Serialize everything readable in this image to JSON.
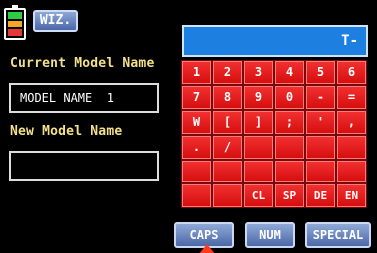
{
  "toolbar": {
    "wizard_label": "WIZ."
  },
  "battery": {
    "icon": "battery-icon"
  },
  "current_model": {
    "label": "Current Model Name",
    "value": "MODEL NAME  1"
  },
  "new_model": {
    "label": "New Model Name",
    "value": ""
  },
  "keyboard": {
    "display": "T-",
    "keys": [
      "1",
      "2",
      "3",
      "4",
      "5",
      "6",
      "7",
      "8",
      "9",
      "0",
      "-",
      "=",
      "W",
      "[",
      "]",
      ";",
      "'",
      ",",
      ".",
      "/",
      "",
      "",
      "",
      "",
      "",
      "",
      "",
      "",
      "",
      "",
      "",
      "",
      "CL",
      "SP",
      "DE",
      "EN"
    ]
  },
  "modes": {
    "caps": "CAPS",
    "num": "NUM",
    "special": "SPECIAL"
  },
  "colors": {
    "accent_blue": "#1d7fe0",
    "key_red": "#e61f1f",
    "label_yellow": "#f3e08a"
  }
}
